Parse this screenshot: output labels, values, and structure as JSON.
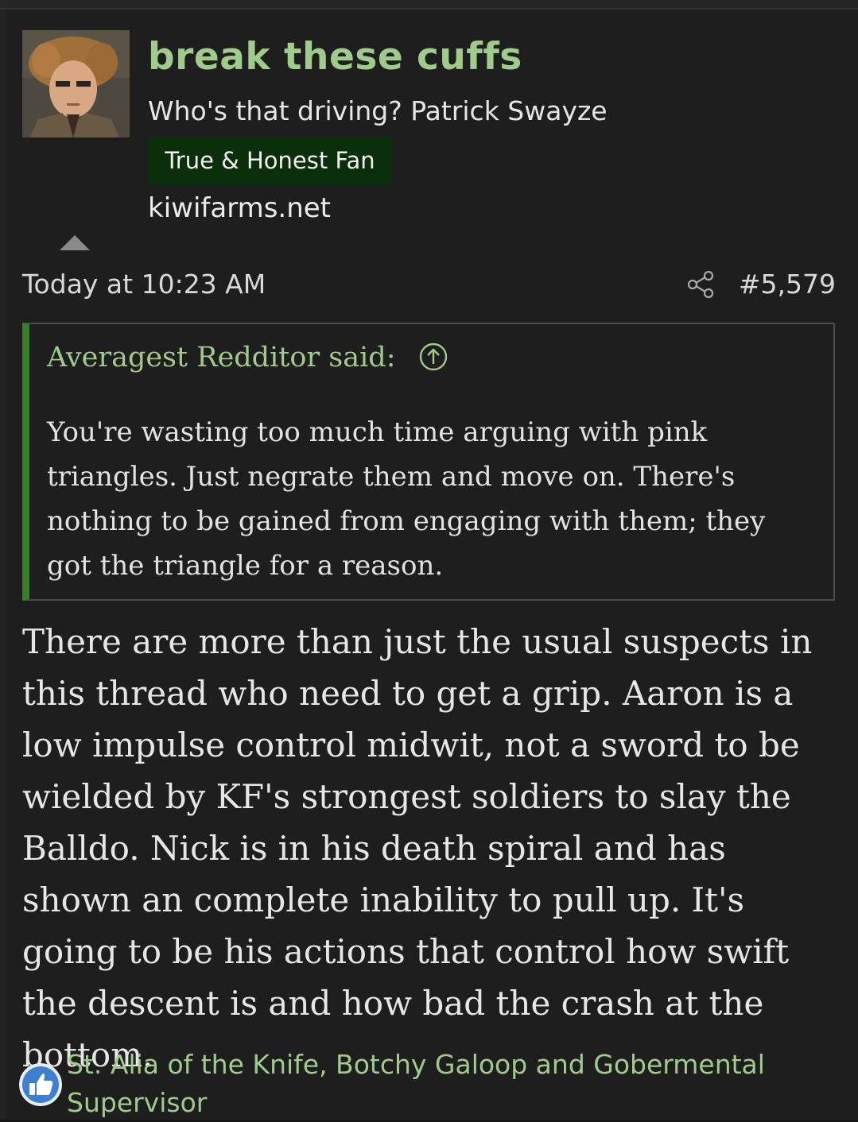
{
  "post": {
    "username": "break these cuffs",
    "user_title": "Who's that driving? Patrick Swayze",
    "user_badge": "True & Honest Fan",
    "user_site": "kiwifarms.net",
    "timestamp": "Today at 10:23 AM",
    "post_number": "#5,579",
    "quote": {
      "attribution": "Averagest Redditor said:",
      "text": "You're wasting too much time arguing with pink triangles. Just negrate them and move on. There's nothing to be gained from engaging with them; they got the triangle for a reason."
    },
    "body": "There are more than just the usual suspects in this thread who need to get a grip. Aaron is a low impulse control midwit, not a sword to be wielded by KF's strongest soldiers to slay the Balldo. Nick is in his death spiral and has shown an complete inability to pull up. It's going to be his actions that control how swift the descent is and how bad the crash at the bottom.",
    "reactions": {
      "icon": "thumbs-up-icon",
      "users": "St. Alia of the Knife, Botchy Galoop and Gobermental Supervisor"
    }
  },
  "colors": {
    "accent_green": "#9fcc8a",
    "badge_bg": "#0b2f0b",
    "quote_bar": "#3a7d2a",
    "background": "#1e1e1e"
  }
}
